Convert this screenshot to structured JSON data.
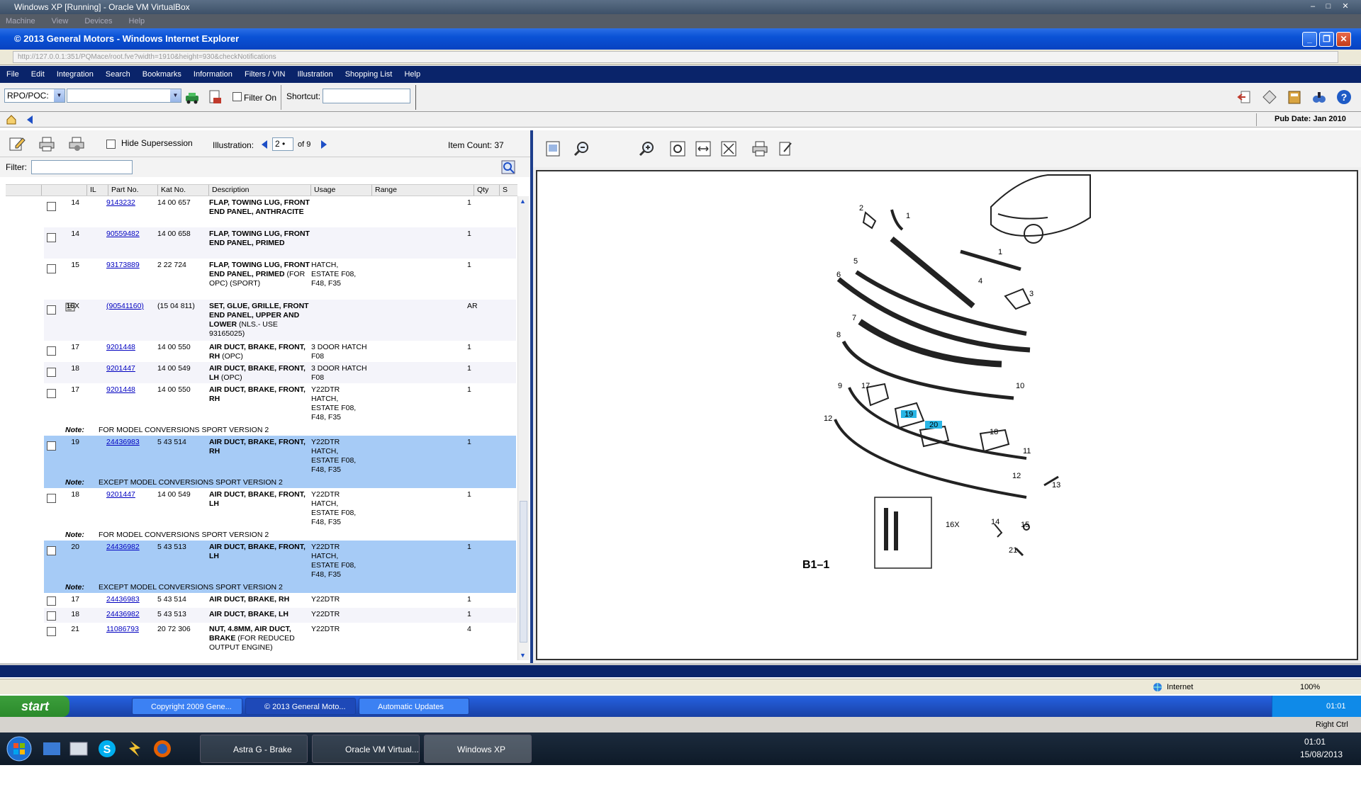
{
  "vbox": {
    "title": "Windows XP [Running] - Oracle VM VirtualBox",
    "menu": [
      "Machine",
      "View",
      "Devices",
      "Help"
    ]
  },
  "ie": {
    "title": "© 2013 General Motors - Windows Internet Explorer",
    "address": "http://127.0.0.1:351/PQMace/root.fve?width=1910&height=930&checkNotifications"
  },
  "app_menu": [
    "File",
    "Edit",
    "Integration",
    "Search",
    "Bookmarks",
    "Information",
    "Filters / VIN",
    "Illustration",
    "Shopping List",
    "Help"
  ],
  "toolbar": {
    "rpo_label": "RPO/POC:",
    "filter_on_label": "Filter On",
    "shortcut_label": "Shortcut:",
    "shortcut_value": ""
  },
  "pub_date": "Pub Date: Jan 2010",
  "left": {
    "hide_supersession": "Hide Supersession",
    "illustration_label": "Illustration:",
    "illustration_page": "2",
    "illustration_of": "of 9",
    "item_count": "Item Count: 37",
    "filter_label": "Filter:",
    "filter_value": "",
    "columns": [
      "IL",
      "Part No.",
      "Kat No.",
      "Description",
      "Usage",
      "Range",
      "Qty",
      "S"
    ],
    "rows": [
      {
        "il": "14",
        "part": "9143232",
        "kat": "14 00 657",
        "desc": "Flap, Towing Lug, Front End Panel, Anthracite",
        "sub": "",
        "usage": "",
        "qty": "1"
      },
      {
        "il": "14",
        "part": "90559482",
        "kat": "14 00 658",
        "desc": "Flap, Towing Lug, Front End Panel, Primed",
        "sub": "",
        "usage": "",
        "qty": "1"
      },
      {
        "il": "15",
        "part": "93173889",
        "kat": "2 22 724",
        "desc": "Flap, Towing Lug, Front End Panel, Primed",
        "sub": "(For OPC) (Sport)",
        "usage": "HATCH, ESTATE F08, F48, F35",
        "qty": "1"
      },
      {
        "il": "16X",
        "part": "(90541160)",
        "kat": "(15 04 811)",
        "desc": "Set, Glue, Grille, Front End Panel, Upper and Lower",
        "sub": "(NLS.- Use 93165025)",
        "usage": "",
        "qty": "AR"
      },
      {
        "il": "17",
        "part": "9201448",
        "kat": "14 00 550",
        "desc": "Air Duct, Brake, Front, RH",
        "sub": "(OPC)",
        "usage": "3 DOOR HATCH F08",
        "qty": "1"
      },
      {
        "il": "18",
        "part": "9201447",
        "kat": "14 00 549",
        "desc": "Air Duct, Brake, Front, LH",
        "sub": "(OPC)",
        "usage": "3 DOOR HATCH F08",
        "qty": "1"
      },
      {
        "il": "17",
        "part": "9201448",
        "kat": "14 00 550",
        "desc": "Air Duct, Brake, Front, RH",
        "sub": "",
        "usage": "Y22DTR HATCH, ESTATE F08, F48, F35",
        "qty": "1"
      },
      {
        "il": "19",
        "part": "24436983",
        "kat": "5 43 514",
        "desc": "Air Duct, Brake, Front, RH",
        "sub": "",
        "usage": "Y22DTR HATCH, ESTATE F08, F48, F35",
        "qty": "1"
      },
      {
        "il": "18",
        "part": "9201447",
        "kat": "14 00 549",
        "desc": "Air Duct, Brake, Front, LH",
        "sub": "",
        "usage": "Y22DTR HATCH, ESTATE F08, F48, F35",
        "qty": "1"
      },
      {
        "il": "20",
        "part": "24436982",
        "kat": "5 43 513",
        "desc": "Air Duct, Brake, Front, LH",
        "sub": "",
        "usage": "Y22DTR HATCH, ESTATE F08, F48, F35",
        "qty": "1"
      },
      {
        "il": "17",
        "part": "24436983",
        "kat": "5 43 514",
        "desc": "Air Duct, Brake, RH",
        "sub": "",
        "usage": "Y22DTR",
        "qty": "1"
      },
      {
        "il": "18",
        "part": "24436982",
        "kat": "5 43 513",
        "desc": "Air Duct, Brake, LH",
        "sub": "",
        "usage": "Y22DTR",
        "qty": "1"
      },
      {
        "il": "21",
        "part": "11086793",
        "kat": "20 72 306",
        "desc": "Nut, 4.8mm, Air Duct, Brake",
        "sub": "(For Reduced Output Engine)",
        "usage": "Y22DTR",
        "qty": "4"
      }
    ],
    "notes": [
      {
        "label": "Note:",
        "text": "FOR MODEL CONVERSIONS SPORT VERSION 2"
      },
      {
        "label": "Note:",
        "text": "EXCEPT MODEL CONVERSIONS SPORT VERSION 2"
      },
      {
        "label": "Note:",
        "text": "FOR MODEL CONVERSIONS SPORT VERSION 2"
      },
      {
        "label": "Note:",
        "text": "EXCEPT MODEL CONVERSIONS SPORT VERSION 2"
      }
    ]
  },
  "illustration": {
    "ref": "B1–1",
    "callouts": [
      "1",
      "1",
      "2",
      "3",
      "4",
      "5",
      "6",
      "7",
      "8",
      "9",
      "10",
      "11",
      "12",
      "12",
      "13",
      "14",
      "15",
      "16X",
      "17",
      "18",
      "19",
      "20",
      "21"
    ]
  },
  "ie_status": {
    "zone": "Internet",
    "zoom": "100%"
  },
  "xp_taskbar": {
    "start": "start",
    "tasks": [
      "Copyright 2009 Gene...",
      "© 2013 General Moto...",
      "Automatic Updates"
    ],
    "clock": "01:01"
  },
  "vb_status": {
    "host_key": "Right Ctrl"
  },
  "win7": {
    "tasks": [
      "Astra G - Brake D...",
      "Oracle VM Virtual...",
      "Windows XP [Run..."
    ],
    "time": "01:01",
    "date": "15/08/2013"
  }
}
